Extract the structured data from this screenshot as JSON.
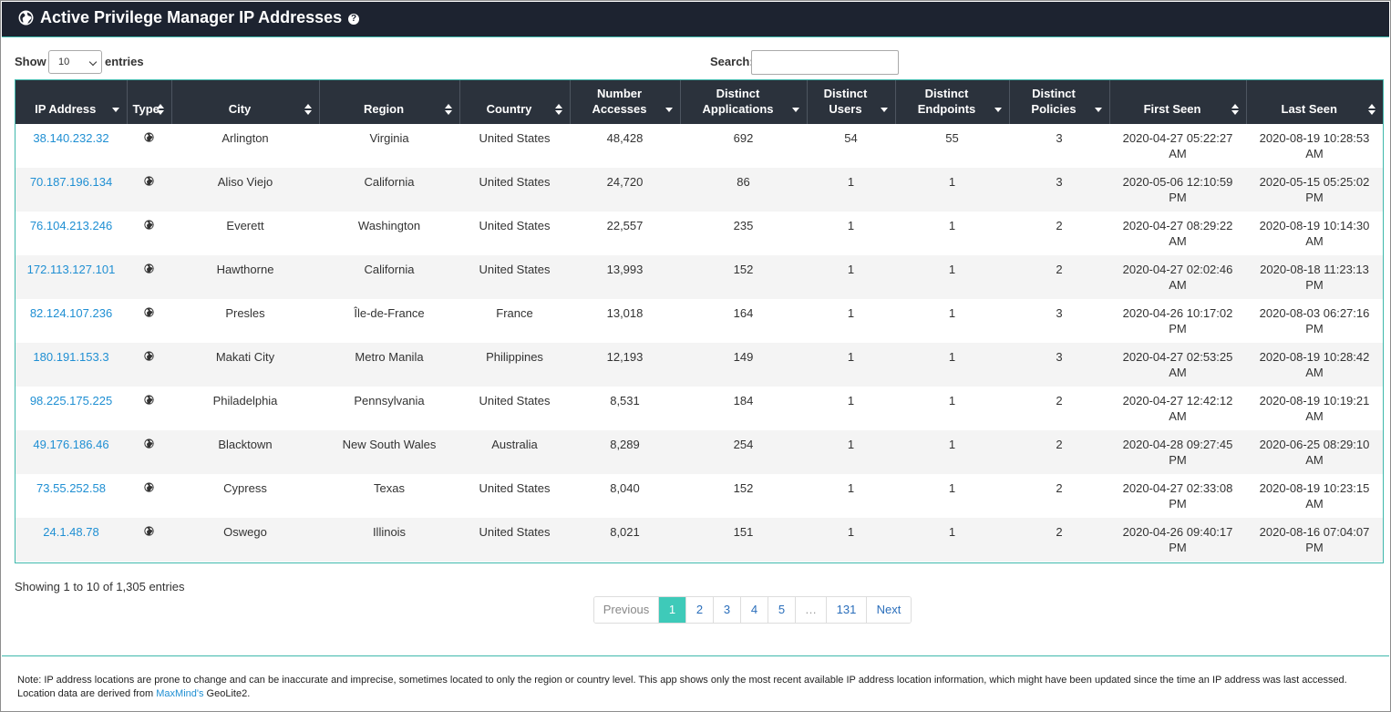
{
  "header": {
    "title": "Active Privilege Manager IP Addresses",
    "help_glyph": "?"
  },
  "controls": {
    "show_label": "Show",
    "entries_value": "10",
    "entries_label": "entries",
    "search_label": "Search:",
    "search_value": ""
  },
  "table": {
    "columns": [
      {
        "label": "IP Address",
        "sort": "desc"
      },
      {
        "label": "Type",
        "sort": "both"
      },
      {
        "label": "City",
        "sort": "both"
      },
      {
        "label": "Region",
        "sort": "both"
      },
      {
        "label": "Country",
        "sort": "both"
      },
      {
        "label": "Number Accesses",
        "sort": "desc"
      },
      {
        "label": "Distinct Applications",
        "sort": "desc"
      },
      {
        "label": "Distinct Users",
        "sort": "desc"
      },
      {
        "label": "Distinct Endpoints",
        "sort": "desc"
      },
      {
        "label": "Distinct Policies",
        "sort": "desc"
      },
      {
        "label": "First Seen",
        "sort": "both"
      },
      {
        "label": "Last Seen",
        "sort": "both"
      }
    ],
    "rows": [
      {
        "ip": "38.140.232.32",
        "type": "globe-icon",
        "city": "Arlington",
        "region": "Virginia",
        "country": "United States",
        "accesses": "48,428",
        "apps": "692",
        "users": "54",
        "endpoints": "55",
        "policies": "3",
        "first_seen": "2020-04-27 05:22:27 AM",
        "last_seen": "2020-08-19 10:28:53 AM"
      },
      {
        "ip": "70.187.196.134",
        "type": "globe-icon",
        "city": "Aliso Viejo",
        "region": "California",
        "country": "United States",
        "accesses": "24,720",
        "apps": "86",
        "users": "1",
        "endpoints": "1",
        "policies": "3",
        "first_seen": "2020-05-06 12:10:59 PM",
        "last_seen": "2020-05-15 05:25:02 PM"
      },
      {
        "ip": "76.104.213.246",
        "type": "globe-icon",
        "city": "Everett",
        "region": "Washington",
        "country": "United States",
        "accesses": "22,557",
        "apps": "235",
        "users": "1",
        "endpoints": "1",
        "policies": "2",
        "first_seen": "2020-04-27 08:29:22 AM",
        "last_seen": "2020-08-19 10:14:30 AM"
      },
      {
        "ip": "172.113.127.101",
        "type": "globe-icon",
        "city": "Hawthorne",
        "region": "California",
        "country": "United States",
        "accesses": "13,993",
        "apps": "152",
        "users": "1",
        "endpoints": "1",
        "policies": "2",
        "first_seen": "2020-04-27 02:02:46 AM",
        "last_seen": "2020-08-18 11:23:13 PM"
      },
      {
        "ip": "82.124.107.236",
        "type": "globe-icon",
        "city": "Presles",
        "region": "Île-de-France",
        "country": "France",
        "accesses": "13,018",
        "apps": "164",
        "users": "1",
        "endpoints": "1",
        "policies": "3",
        "first_seen": "2020-04-26 10:17:02 PM",
        "last_seen": "2020-08-03 06:27:16 PM"
      },
      {
        "ip": "180.191.153.3",
        "type": "globe-icon",
        "city": "Makati City",
        "region": "Metro Manila",
        "country": "Philippines",
        "accesses": "12,193",
        "apps": "149",
        "users": "1",
        "endpoints": "1",
        "policies": "3",
        "first_seen": "2020-04-27 02:53:25 AM",
        "last_seen": "2020-08-19 10:28:42 AM"
      },
      {
        "ip": "98.225.175.225",
        "type": "globe-icon",
        "city": "Philadelphia",
        "region": "Pennsylvania",
        "country": "United States",
        "accesses": "8,531",
        "apps": "184",
        "users": "1",
        "endpoints": "1",
        "policies": "2",
        "first_seen": "2020-04-27 12:42:12 AM",
        "last_seen": "2020-08-19 10:19:21 AM"
      },
      {
        "ip": "49.176.186.46",
        "type": "globe-icon",
        "city": "Blacktown",
        "region": "New South Wales",
        "country": "Australia",
        "accesses": "8,289",
        "apps": "254",
        "users": "1",
        "endpoints": "1",
        "policies": "2",
        "first_seen": "2020-04-28 09:27:45 PM",
        "last_seen": "2020-06-25 08:29:10 AM"
      },
      {
        "ip": "73.55.252.58",
        "type": "globe-icon",
        "city": "Cypress",
        "region": "Texas",
        "country": "United States",
        "accesses": "8,040",
        "apps": "152",
        "users": "1",
        "endpoints": "1",
        "policies": "2",
        "first_seen": "2020-04-27 02:33:08 PM",
        "last_seen": "2020-08-19 10:23:15 AM"
      },
      {
        "ip": "24.1.48.78",
        "type": "globe-icon",
        "city": "Oswego",
        "region": "Illinois",
        "country": "United States",
        "accesses": "8,021",
        "apps": "151",
        "users": "1",
        "endpoints": "1",
        "policies": "2",
        "first_seen": "2020-04-26 09:40:17 PM",
        "last_seen": "2020-08-16 07:04:07 PM"
      }
    ]
  },
  "info": "Showing 1 to 10 of 1,305 entries",
  "pagination": [
    {
      "label": "Previous",
      "state": "disabled"
    },
    {
      "label": "1",
      "state": "active"
    },
    {
      "label": "2",
      "state": "normal"
    },
    {
      "label": "3",
      "state": "normal"
    },
    {
      "label": "4",
      "state": "normal"
    },
    {
      "label": "5",
      "state": "normal"
    },
    {
      "label": "…",
      "state": "ellipsis"
    },
    {
      "label": "131",
      "state": "normal"
    },
    {
      "label": "Next",
      "state": "normal"
    }
  ],
  "footer": {
    "note_prefix": "Note: IP address locations are prone to change and can be inaccurate and imprecise, sometimes located to only the region or country level. This app shows only the most recent available IP address location information, which might have been updated since the time an IP address was last accessed. Location data are derived from ",
    "link_text": "MaxMind's",
    "note_suffix": " GeoLite2."
  },
  "colors": {
    "header_bg": "#1d2330",
    "table_header_bg": "#2b323c",
    "accent": "#3fb8ac",
    "active_page": "#3ecab9",
    "link": "#1f8fd3"
  }
}
